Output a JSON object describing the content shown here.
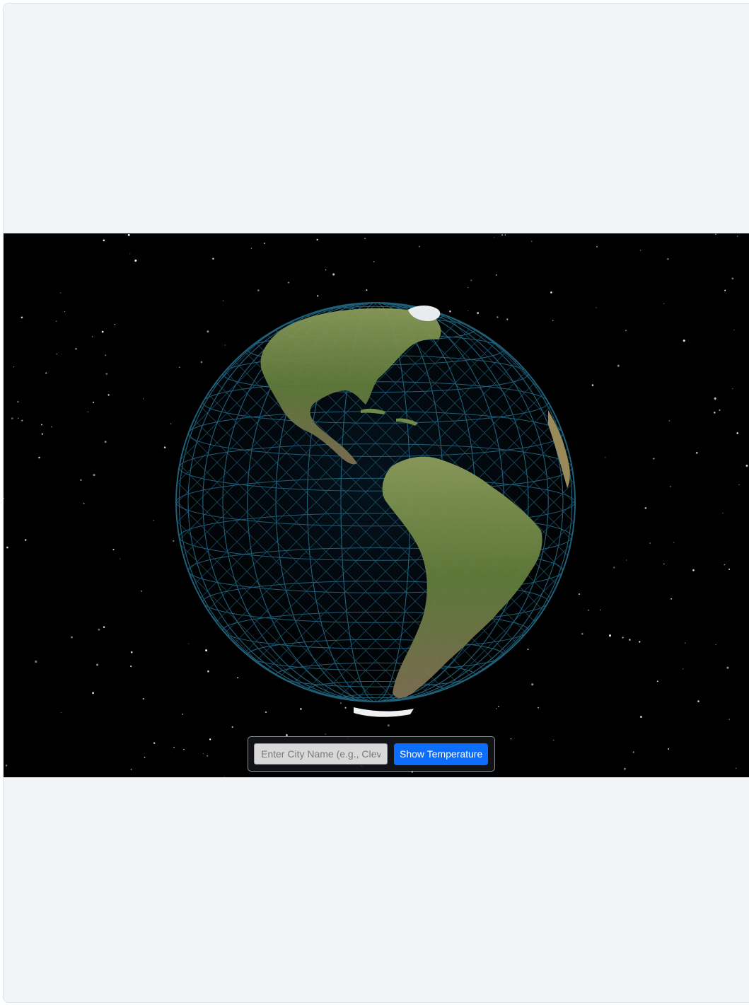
{
  "scene": {
    "description_hidden": false,
    "colors": {
      "page_background": "#f2f5f8",
      "space": "#000000",
      "wireframe": "#1f5f78",
      "button": "#0d6efd"
    },
    "icons": [
      "globe-wireframe",
      "star-field"
    ]
  },
  "controls": {
    "city_input_placeholder": "Enter City Name (e.g., Cleveland)",
    "city_input_value": "",
    "show_button_label": "Show Temperature"
  }
}
